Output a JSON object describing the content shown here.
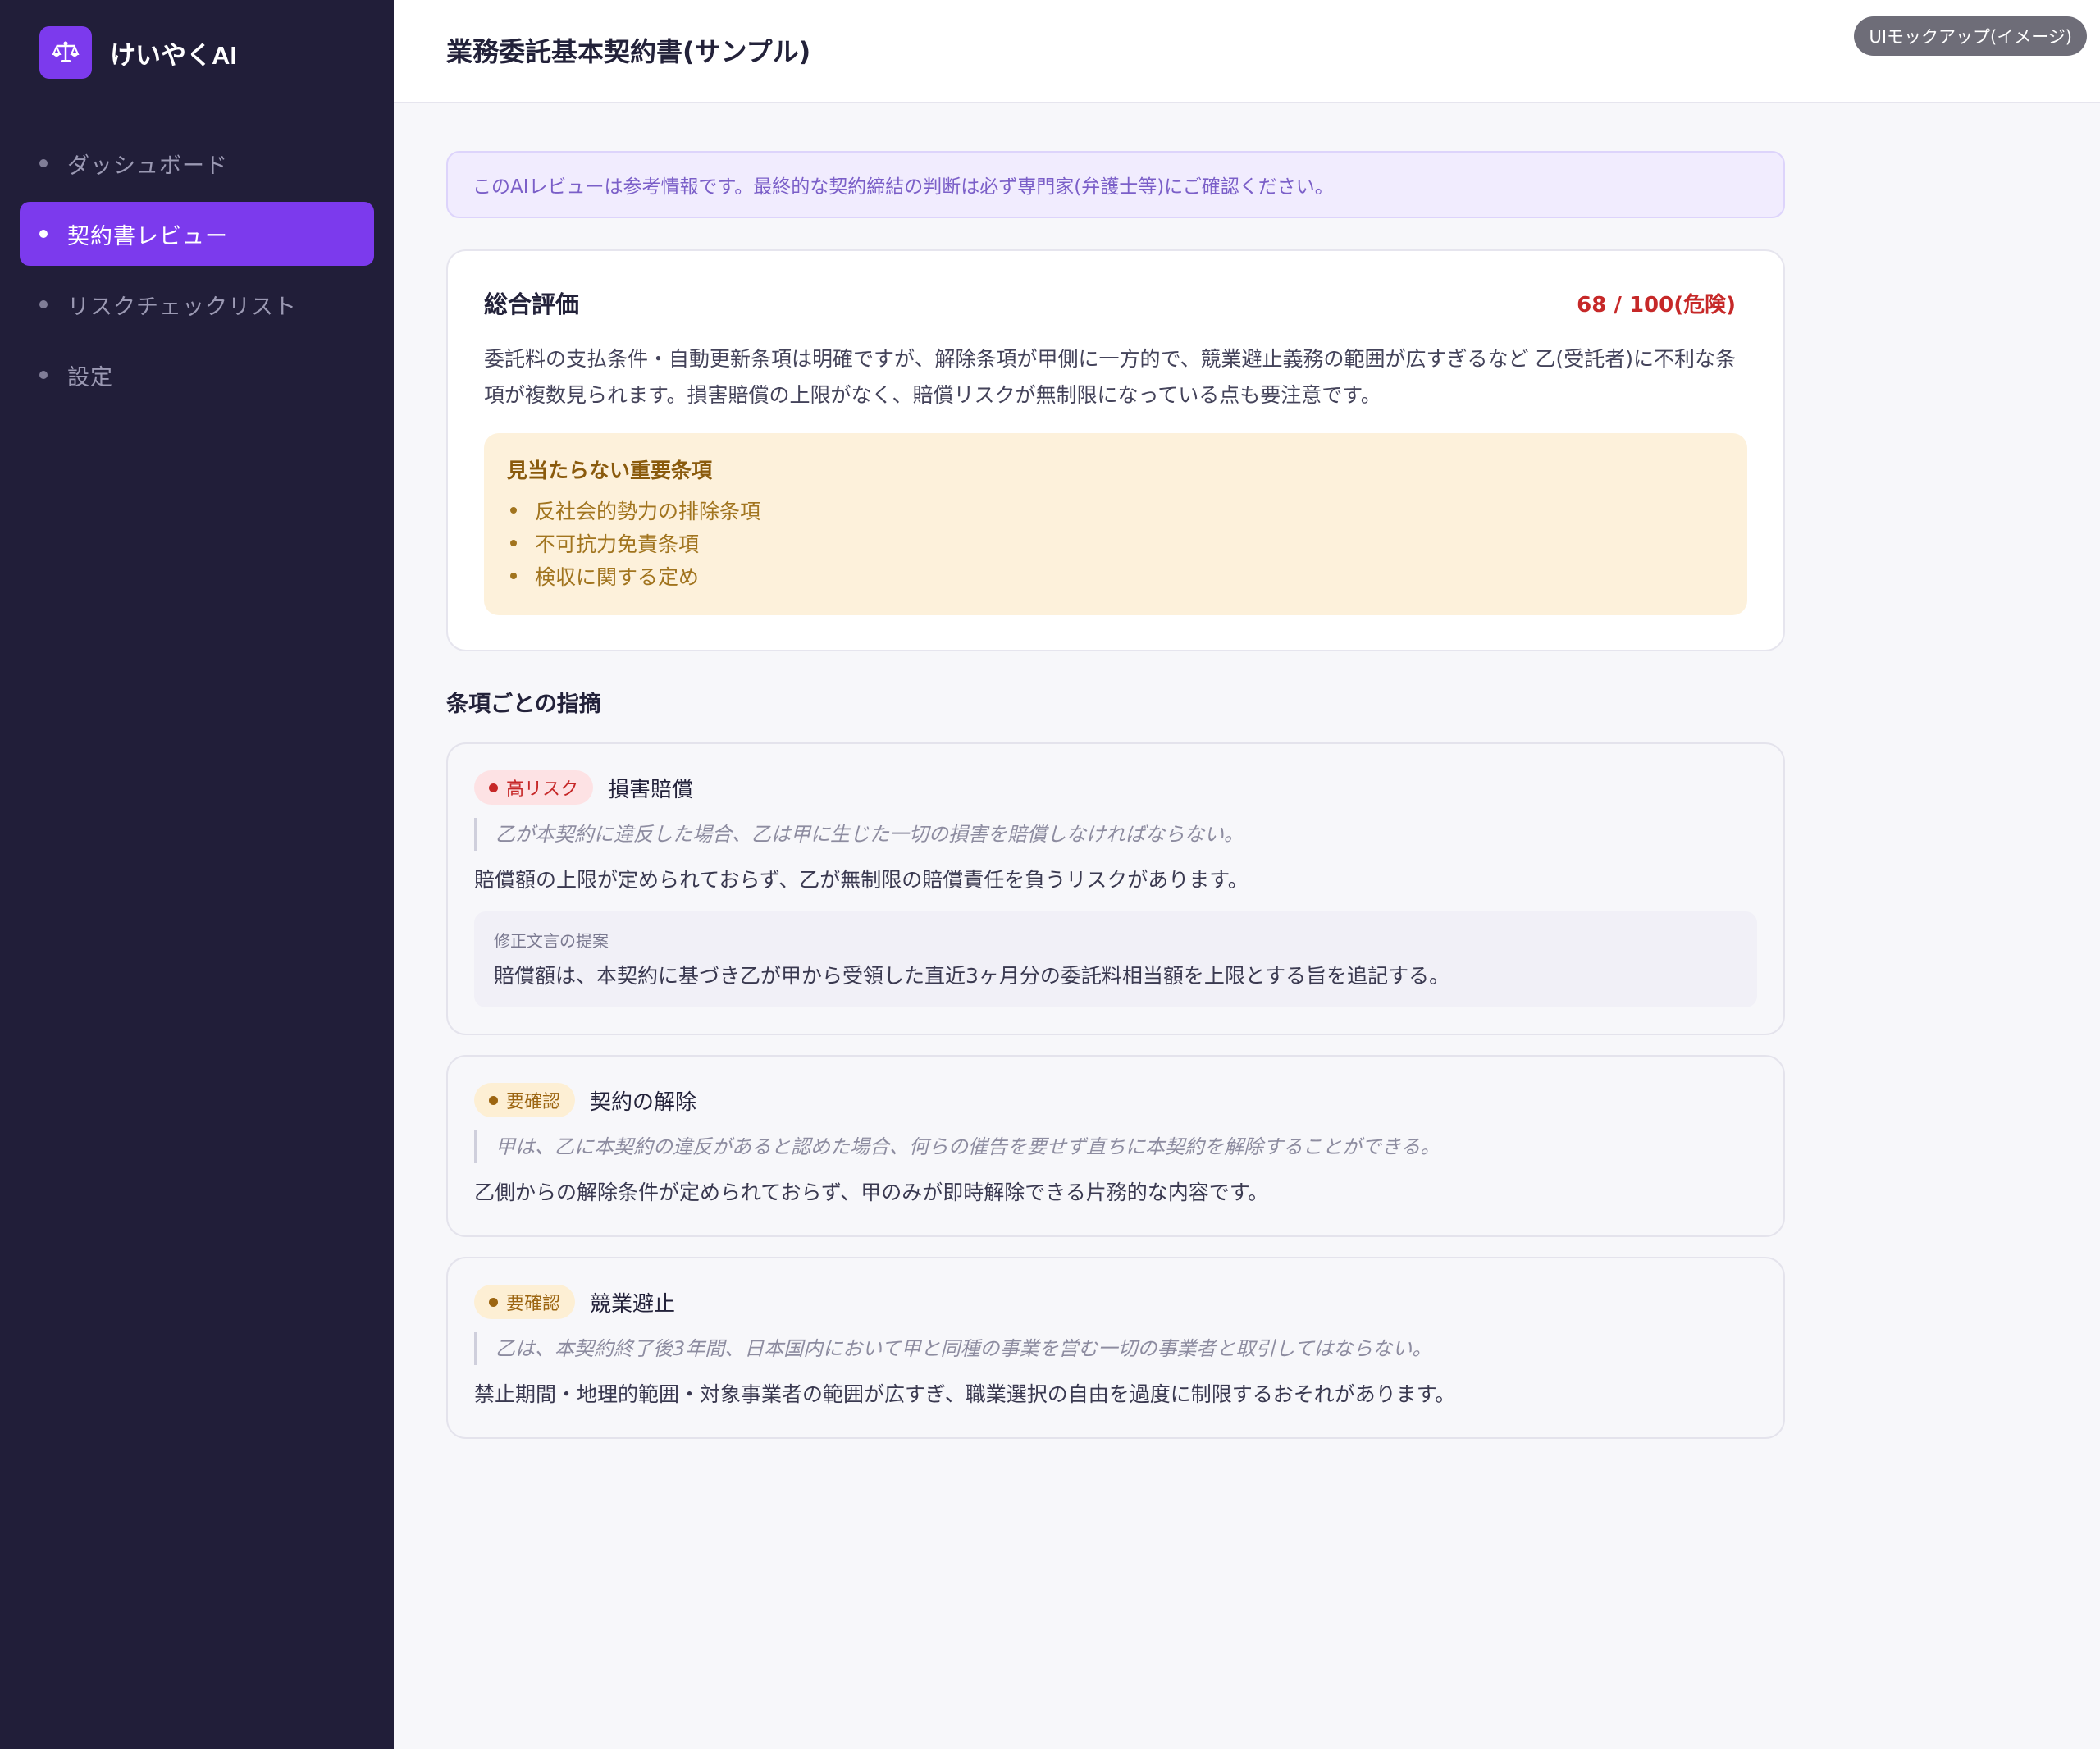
{
  "brand": {
    "name": "けいやくAI",
    "icon": "scales-icon",
    "accent": "#7c3aed"
  },
  "nav": {
    "items": [
      {
        "label": "ダッシュボード",
        "active": false
      },
      {
        "label": "契約書レビュー",
        "active": true
      },
      {
        "label": "リスクチェックリスト",
        "active": false
      },
      {
        "label": "設定",
        "active": false
      }
    ]
  },
  "header": {
    "title": "業務委託基本契約書(サンプル)",
    "badge": "UIモックアップ(イメージ)"
  },
  "notice": "このAIレビューは参考情報です。最終的な契約締結の判断は必ず専門家(弁護士等)にご確認ください。",
  "summary": {
    "title": "総合評価",
    "score": "68 / 100(危険)",
    "text": "委託料の支払条件・自動更新条項は明確ですが、解除条項が甲側に一方的で、競業避止義務の範囲が広すぎるなど 乙(受託者)に不利な条項が複数見られます。損害賠償の上限がなく、賠償リスクが無制限になっている点も要注意です。",
    "missing_title": "見当たらない重要条項",
    "missing_items": [
      "反社会的勢力の排除条項",
      "不可抗力免責条項",
      "検収に関する定め"
    ]
  },
  "issues_title": "条項ごとの指摘",
  "issues": [
    {
      "tag": "高リスク",
      "level": "high",
      "name": "損害賠償",
      "quote": "乙が本契約に違反した場合、乙は甲に生じた一切の損害を賠償しなければならない。",
      "comment": "賠償額の上限が定められておらず、乙が無制限の賠償責任を負うリスクがあります。",
      "suggest_label": "修正文言の提案",
      "suggest_text": "賠償額は、本契約に基づき乙が甲から受領した直近3ヶ月分の委託料相当額を上限とする旨を追記する。"
    },
    {
      "tag": "要確認",
      "level": "confirm",
      "name": "契約の解除",
      "quote": "甲は、乙に本契約の違反があると認めた場合、何らの催告を要せず直ちに本契約を解除することができる。",
      "comment": "乙側からの解除条件が定められておらず、甲のみが即時解除できる片務的な内容です。"
    },
    {
      "tag": "要確認",
      "level": "confirm",
      "name": "競業避止",
      "quote": "乙は、本契約終了後3年間、日本国内において甲と同種の事業を営む一切の事業者と取引してはならない。",
      "comment": "禁止期間・地理的範囲・対象事業者の範囲が広すぎ、職業選択の自由を過度に制限するおそれがあります。"
    }
  ],
  "colors": {
    "sidebar_bg": "#211e39",
    "accent": "#7c3aed",
    "danger": "#c62828",
    "warning": "#9c6511"
  }
}
